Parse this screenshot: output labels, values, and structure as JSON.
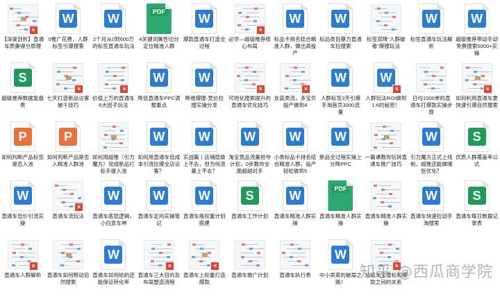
{
  "watermark": "知乎 @西瓜商学院",
  "colors": {
    "word": "#2b7cd3",
    "ppt": "#e8713c",
    "xls": "#1f9a5a",
    "pdf": "#2ea86f",
    "error": "#e0432f"
  },
  "files": [
    {
      "name": "【深度剖析】直通车质量得分原理",
      "kind": "image",
      "mark": true
    },
    {
      "name": "0推广花费，人群标签引爆搜索",
      "kind": "word",
      "mark": false
    },
    {
      "name": "2个月从0到600万的标签直通车玩法",
      "kind": "word",
      "mark": false
    },
    {
      "name": "4关键词属性切分定位精准人群",
      "kind": "pdf",
      "mark": false
    },
    {
      "name": "爆款直通车打造全过程",
      "kind": "word",
      "mark": false
    },
    {
      "name": "必学—超级推荐核心布局",
      "kind": "image",
      "mark": true
    },
    {
      "name": "标品卡排名结合精准人群，做出高投产",
      "kind": "word",
      "mark": false
    },
    {
      "name": "标品类目暴力直通车拉搜索",
      "kind": "word",
      "mark": false
    },
    {
      "name": "标签双降“人群破者”爆搜玩法",
      "kind": "image",
      "mark": false
    },
    {
      "name": "标签直通车玩法解析",
      "kind": "word",
      "mark": false
    },
    {
      "name": "超级推荐带动手动免费搜索5000+实操",
      "kind": "word",
      "mark": false
    },
    {
      "name": "超级推荐数据复盘表",
      "kind": "xls",
      "mark": false
    },
    {
      "name": "七天打造新品访客破千技巧",
      "kind": "image",
      "mark": true
    },
    {
      "name": "价值上万的直通车6大因子玩法",
      "kind": "image",
      "mark": true
    },
    {
      "name": "降低直通车PPC调整重点",
      "kind": "word",
      "mark": false
    },
    {
      "name": "降维爆搜-竞价拉搜实操分享",
      "kind": "word",
      "mark": false
    },
    {
      "name": "可视化搜索提升的直通车优化技巧",
      "kind": "image",
      "mark": true
    },
    {
      "name": "女装类流，多宝贝投产做到4",
      "kind": "image",
      "mark": true
    },
    {
      "name": "人群标签3天引爆手淘首页3000流量",
      "kind": "word",
      "mark": false
    },
    {
      "name": "人群玩法ROI做到1:6的秘密！",
      "kind": "word",
      "mark": true
    },
    {
      "name": "日均1000单的直通车打爆款实操步骤",
      "kind": "image",
      "mark": false
    },
    {
      "name": "如何利用直通车更快速引爆自然搜索",
      "kind": "image",
      "mark": true
    },
    {
      "name": "如何判断产品标签是否入池",
      "kind": "ppt",
      "mark": false
    },
    {
      "name": "如何判断产品是否入精准人群池",
      "kind": "ppt",
      "mark": false
    },
    {
      "name": "如何用超推（引力魔方）完成新品打标手提入池",
      "kind": "image",
      "mark": false
    },
    {
      "name": "如何用直通车低成本引流拉爆全店访客？",
      "kind": "word",
      "mark": false
    },
    {
      "name": "实战篇丨店铺层级上不去，但为何流量上不去？",
      "kind": "word",
      "mark": false
    },
    {
      "name": "淘宝竞品流量抢夺计划，0步教你全面超越对手",
      "kind": "word",
      "mark": false
    },
    {
      "name": "小类标品卡排名结合精准人群，投产轻松做到5",
      "kind": "word",
      "mark": false
    },
    {
      "name": "新品全过程实操上分降PPC",
      "kind": "word",
      "mark": false
    },
    {
      "name": "一篇课教你玩转直通车推广技巧",
      "kind": "image",
      "mark": false
    },
    {
      "name": "引力魔方正式上线前，超推还能做哪些优化？",
      "kind": "word",
      "mark": false
    },
    {
      "name": "优质人群覆盖率公式",
      "kind": "xls",
      "mark": false
    },
    {
      "name": "直通车低价引流实操",
      "kind": "word",
      "mark": false
    },
    {
      "name": "直通车流玩法",
      "kind": "image",
      "mark": true
    },
    {
      "name": "直通车底层逻辑，小白变车神",
      "kind": "word",
      "mark": false
    },
    {
      "name": "直通车定向实操笔记",
      "kind": "word",
      "mark": false
    },
    {
      "name": "直通车拖权重计划搭建",
      "kind": "word",
      "mark": false
    },
    {
      "name": "直通车工作计划",
      "kind": "xls",
      "mark": false
    },
    {
      "name": "直通车精准人群实操",
      "kind": "word",
      "mark": false
    },
    {
      "name": "直通车精准人群实操",
      "kind": "pdf",
      "mark": false
    },
    {
      "name": "直通车精准人群实操",
      "kind": "image",
      "mark": false
    },
    {
      "name": "直通车快速拉动手淘搜索",
      "kind": "word",
      "mark": false
    },
    {
      "name": "直通车每日数据记录表",
      "kind": "xls",
      "mark": false
    },
    {
      "name": "直通车人群解析",
      "kind": "image",
      "mark": true
    },
    {
      "name": "直通车如何帮动自然搜索",
      "kind": "image",
      "mark": false
    },
    {
      "name": "直通车如何给的还能保证转化率",
      "kind": "word",
      "mark": false
    },
    {
      "name": "直通车三大目的及布局塑造流程",
      "kind": "image",
      "mark": true
    },
    {
      "name": "直通车上权重打造爆款",
      "kind": "image",
      "mark": true
    },
    {
      "name": "直通车推广计划",
      "kind": "image",
      "mark": false
    },
    {
      "name": "直通车执行表",
      "kind": "image",
      "mark": false
    },
    {
      "name": "中小卖家的破局之路！",
      "kind": "word",
      "mark": false
    },
    {
      "name": "总结淘宝搜权和爆款之间的关系",
      "kind": "image",
      "mark": true
    }
  ]
}
